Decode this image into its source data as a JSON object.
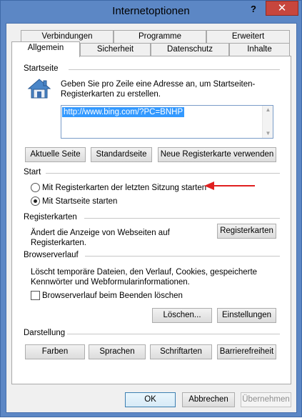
{
  "window": {
    "title": "Internetoptionen",
    "help_glyph": "?",
    "close_glyph": "✕"
  },
  "tabs": {
    "row1": [
      "Verbindungen",
      "Programme",
      "Erweitert"
    ],
    "row2": [
      "Allgemein",
      "Sicherheit",
      "Datenschutz",
      "Inhalte"
    ],
    "active": "Allgemein"
  },
  "startseite": {
    "heading": "Startseite",
    "description": "Geben Sie pro Zeile eine Adresse an, um Startseiten-Registerkarten zu erstellen.",
    "desc_line1": "Geben Sie pro Zeile eine Adresse an, um Startseiten-",
    "desc_line2": "Registerkarten zu erstellen.",
    "url": "http://www.bing.com/?PC=BNHP",
    "btn_current": "Aktuelle Seite",
    "btn_default": "Standardseite",
    "btn_newtab": "Neue Registerkarte verwenden"
  },
  "start": {
    "heading": "Start",
    "option1": "Mit Registerkarten der letzten Sitzung starten",
    "option2": "Mit Startseite starten",
    "selected": "option2",
    "arrow_color": "#e02020"
  },
  "registerkarten": {
    "heading": "Registerkarten",
    "line1": "Ändert die Anzeige von Webseiten auf",
    "line2": "Registerkarten.",
    "button": "Registerkarten"
  },
  "browserverlauf": {
    "heading": "Browserverlauf",
    "line1": "Löscht temporäre Dateien, den Verlauf, Cookies, gespeicherte",
    "line2": "Kennwörter und Webformularinformationen.",
    "checkbox_label": "Browserverlauf beim Beenden löschen",
    "checkbox_checked": false,
    "btn_delete": "Löschen...",
    "btn_settings": "Einstellungen"
  },
  "darstellung": {
    "heading": "Darstellung",
    "buttons": [
      "Farben",
      "Sprachen",
      "Schriftarten",
      "Barrierefreiheit"
    ]
  },
  "footer": {
    "ok": "OK",
    "cancel": "Abbrechen",
    "apply": "Übernehmen"
  },
  "colors": {
    "titlebar": "#5c87c5",
    "close": "#c7463d",
    "selection": "#3399ff"
  }
}
